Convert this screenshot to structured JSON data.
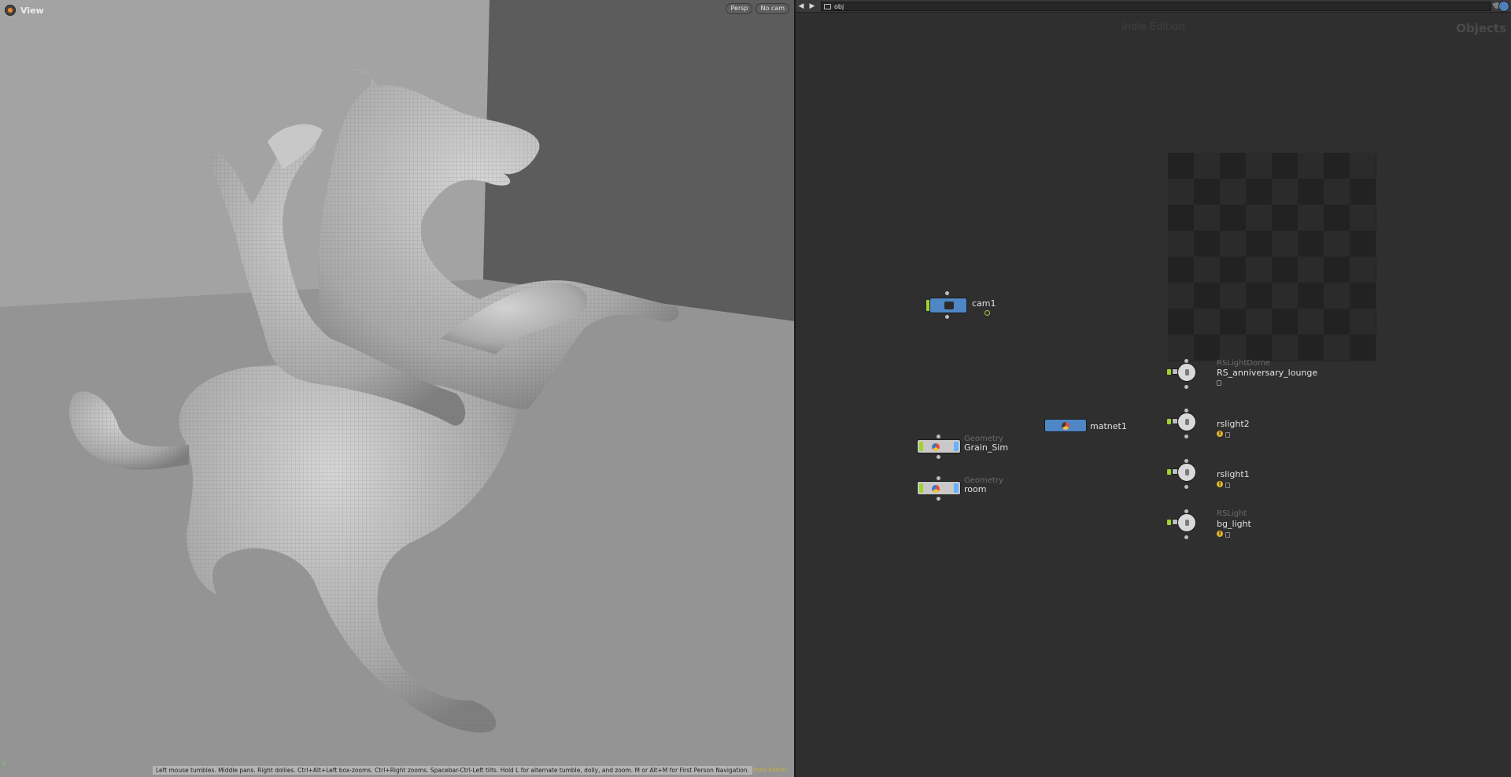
{
  "viewport": {
    "title": "View",
    "menus": [
      "Persp",
      "No cam"
    ],
    "hint": "Left mouse tumbles. Middle pans. Right dollies. Ctrl+Alt+Left box-zooms. Ctrl+Right zooms. Spacebar-Ctrl-Left tilts. Hold L for alternate tumble, dolly, and zoom. M or Alt+M for First Person Navigation.",
    "edition": "Indie Edition",
    "axis": "Y"
  },
  "network": {
    "path": "obj",
    "edition_watermark": "Indie Edition",
    "context_watermark": "Objects",
    "nodes": {
      "cam1": {
        "name": "cam1"
      },
      "grain_sim": {
        "type": "Geometry",
        "name": "Grain_Sim"
      },
      "room": {
        "type": "Geometry",
        "name": "room"
      },
      "matnet1": {
        "name": "matnet1"
      },
      "rs_anniversary_lounge": {
        "type": "RSLightDome",
        "name": "RS_anniversary_lounge"
      },
      "rslight2": {
        "name": "rslight2"
      },
      "rslight1": {
        "name": "rslight1"
      },
      "bg_light": {
        "type": "RSLight",
        "name": "bg_light"
      }
    }
  },
  "colors": {
    "viewport_bg": "#8e8e8e",
    "network_bg": "#2f2f2f",
    "display_flag": "#9fd32e",
    "camera_node": "#4f86c6",
    "warning": "#e0b52a"
  },
  "icons": [
    "houdini-logo-icon",
    "back-arrow-icon",
    "forward-arrow-icon",
    "obj-context-icon",
    "camera-icon",
    "geometry-icon",
    "material-network-icon",
    "light-icon",
    "warning-icon",
    "lock-icon"
  ]
}
